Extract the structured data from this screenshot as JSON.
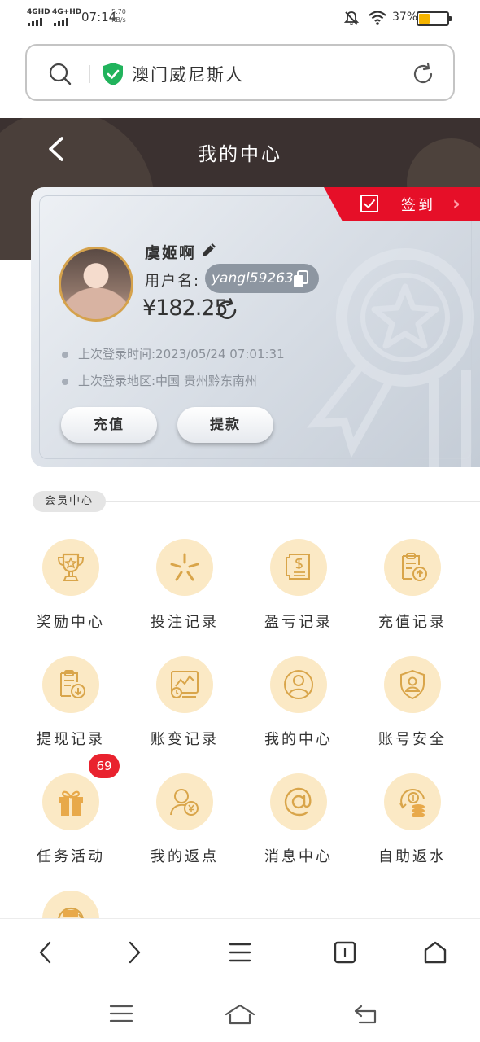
{
  "status": {
    "sim1": "4GHD",
    "sim2": "4G+HD",
    "time": "07:14",
    "speed_value": "5.70",
    "speed_unit": "KB/s",
    "battery": "37%"
  },
  "browser": {
    "url_text": "澳门威尼斯人"
  },
  "header": {
    "title": "我的中心"
  },
  "profile": {
    "signin_label": "签到",
    "nickname": "虞姬啊",
    "username_label": "用户名:",
    "username": "yangl59263",
    "balance": "¥182.25",
    "last_login_time": "上次登录时间:2023/05/24 07:01:31",
    "last_login_place": "上次登录地区:中国 贵州黔东南州",
    "deposit_label": "充值",
    "withdraw_label": "提款"
  },
  "member": {
    "section_title": "会员中心",
    "items": [
      {
        "label": "奖励中心",
        "icon": "trophy-icon"
      },
      {
        "label": "投注记录",
        "icon": "star-burst-icon"
      },
      {
        "label": "盈亏记录",
        "icon": "receipt-icon"
      },
      {
        "label": "充值记录",
        "icon": "clipboard-upload-icon"
      },
      {
        "label": "提现记录",
        "icon": "clipboard-download-icon"
      },
      {
        "label": "账变记录",
        "icon": "chart-monitor-icon"
      },
      {
        "label": "我的中心",
        "icon": "user-circle-icon"
      },
      {
        "label": "账号安全",
        "icon": "shield-user-icon"
      },
      {
        "label": "任务活动",
        "icon": "gift-icon",
        "badge": "69"
      },
      {
        "label": "我的返点",
        "icon": "user-coin-icon"
      },
      {
        "label": "消息中心",
        "icon": "at-icon"
      },
      {
        "label": "自助返水",
        "icon": "coin-stack-icon"
      },
      {
        "label": "",
        "icon": "service-24-7-icon"
      }
    ]
  },
  "colors": {
    "header_bg": "#3b3130",
    "accent_red": "#e60f28",
    "icon_circle": "#fbe9c5",
    "icon_gold": "#d9a54a"
  }
}
